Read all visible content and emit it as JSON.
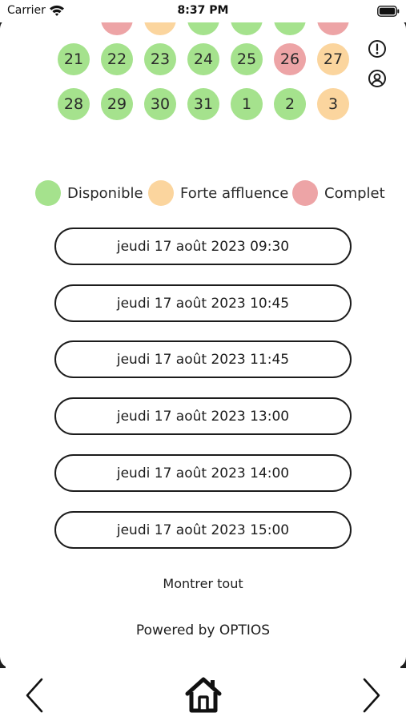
{
  "status_bar": {
    "carrier": "Carrier",
    "time": "8:37 PM"
  },
  "calendar": {
    "weeks": [
      [
        {
          "day": "",
          "status": "complet"
        },
        {
          "day": "",
          "status": "forte"
        },
        {
          "day": "",
          "status": "disponible"
        },
        {
          "day": "",
          "status": "disponible"
        },
        {
          "day": "",
          "status": "disponible"
        },
        {
          "day": "",
          "status": "disponible"
        },
        {
          "day": "",
          "status": "complet"
        }
      ],
      [
        {
          "day": "21",
          "status": "disponible"
        },
        {
          "day": "22",
          "status": "disponible"
        },
        {
          "day": "23",
          "status": "disponible"
        },
        {
          "day": "24",
          "status": "disponible"
        },
        {
          "day": "25",
          "status": "disponible"
        },
        {
          "day": "26",
          "status": "complet"
        },
        {
          "day": "27",
          "status": "forte"
        }
      ],
      [
        {
          "day": "28",
          "status": "disponible"
        },
        {
          "day": "29",
          "status": "disponible"
        },
        {
          "day": "30",
          "status": "disponible"
        },
        {
          "day": "31",
          "status": "disponible"
        },
        {
          "day": "1",
          "status": "disponible"
        },
        {
          "day": "2",
          "status": "disponible"
        },
        {
          "day": "3",
          "status": "forte"
        }
      ]
    ]
  },
  "legend": [
    {
      "label": "Disponible",
      "status": "disponible"
    },
    {
      "label": "Forte affluence",
      "status": "forte"
    },
    {
      "label": "Complet",
      "status": "complet"
    }
  ],
  "colors": {
    "disponible": "#a5e28d",
    "forte": "#fbd59e",
    "complet": "#eda4a6",
    "outline": "#1c1c1c"
  },
  "slots": [
    "jeudi 17 août 2023 09:30",
    "jeudi 17 août 2023 10:45",
    "jeudi 17 août 2023 11:45",
    "jeudi 17 août 2023 13:00",
    "jeudi 17 août 2023 14:00",
    "jeudi 17 août 2023 15:00"
  ],
  "show_all_label": "Montrer tout",
  "powered_by": "Powered by OPTIOS",
  "icons": {
    "side": [
      "info-icon",
      "profile-icon"
    ],
    "nav": [
      "back-chevron-icon",
      "home-icon",
      "forward-chevron-icon"
    ]
  }
}
